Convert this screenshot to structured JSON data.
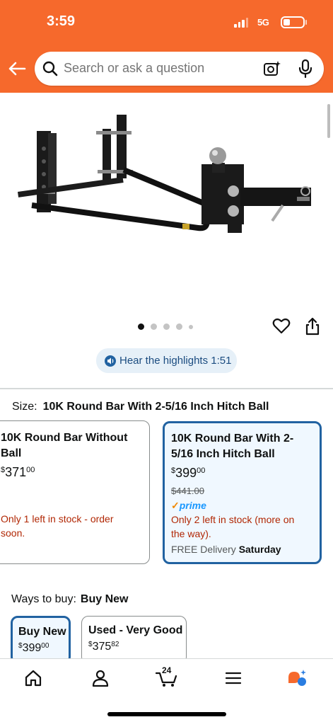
{
  "status_bar": {
    "time": "3:59",
    "network": "5G"
  },
  "search": {
    "placeholder": "Search or ask a question"
  },
  "gallery": {
    "dot_count": 5,
    "active_index": 0,
    "image_alt": "Weight distribution hitch with round bars and 2-5/16 inch hitch ball"
  },
  "highlights": {
    "label": "Hear the highlights 1:51"
  },
  "size": {
    "label": "Size:",
    "selected": "10K Round Bar With 2-5/16 Inch Hitch Ball",
    "options": [
      {
        "title_line1": "10K Round Bar Without",
        "title_line2": "Ball",
        "price_currency": "$",
        "price_whole": "371",
        "price_fraction": "00",
        "stock_line1": "Only 1 left in stock - order",
        "stock_line2": "soon."
      },
      {
        "title_line1": "10K Round Bar With 2-",
        "title_line2": "5/16 Inch Hitch Ball",
        "price_currency": "$",
        "price_whole": "399",
        "price_fraction": "00",
        "was_price": "$441.00",
        "prime": "prime",
        "stock_line1": "Only 2 left in stock (more on",
        "stock_line2": "the way).",
        "delivery_prefix": "FREE Delivery",
        "delivery_day": "Saturday"
      }
    ]
  },
  "ways_to_buy": {
    "label": "Ways to buy:",
    "selected": "Buy New",
    "options": [
      {
        "title": "Buy New",
        "price_currency": "$",
        "price_whole": "399",
        "price_fraction": "00"
      },
      {
        "title": "Used - Very Good",
        "price_currency": "$",
        "price_whole": "375",
        "price_fraction": "82"
      }
    ]
  },
  "bottom_nav": {
    "cart_count": "24",
    "items": [
      "home-icon",
      "account-icon",
      "cart-icon",
      "menu-icon",
      "rufus-icon"
    ]
  },
  "colors": {
    "header": "#f6692c",
    "accent_blue": "#2162a1",
    "stock_red": "#b12704",
    "prime_blue": "#1a98ff"
  }
}
